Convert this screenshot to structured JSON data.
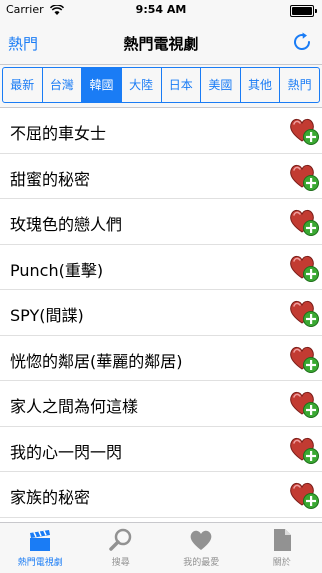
{
  "status": {
    "carrier": "Carrier",
    "time": "9:54 AM"
  },
  "nav": {
    "left": "熱門",
    "title": "熱門電視劇"
  },
  "segments": [
    "最新",
    "台灣",
    "韓國",
    "大陸",
    "日本",
    "美國",
    "其他",
    "熱門"
  ],
  "selected_segment": "韓國",
  "items": [
    "不屈的車女士",
    "甜蜜的秘密",
    "玫瑰色的戀人們",
    "Punch(重擊)",
    "SPY(間諜)",
    "恍惚的鄰居(華麗的鄰居)",
    "家人之間為何這樣",
    "我的心一閃一閃",
    "家族的秘密"
  ],
  "tabs": [
    {
      "label": "熱門電視劇",
      "icon": "clapperboard-icon",
      "active": true
    },
    {
      "label": "搜尋",
      "icon": "search-icon",
      "active": false
    },
    {
      "label": "我的最愛",
      "icon": "heart-icon",
      "active": false
    },
    {
      "label": "關於",
      "icon": "document-icon",
      "active": false
    }
  ],
  "colors": {
    "accent": "#1a7cf5",
    "heart": "#c23b32",
    "plus": "#3aa832"
  }
}
